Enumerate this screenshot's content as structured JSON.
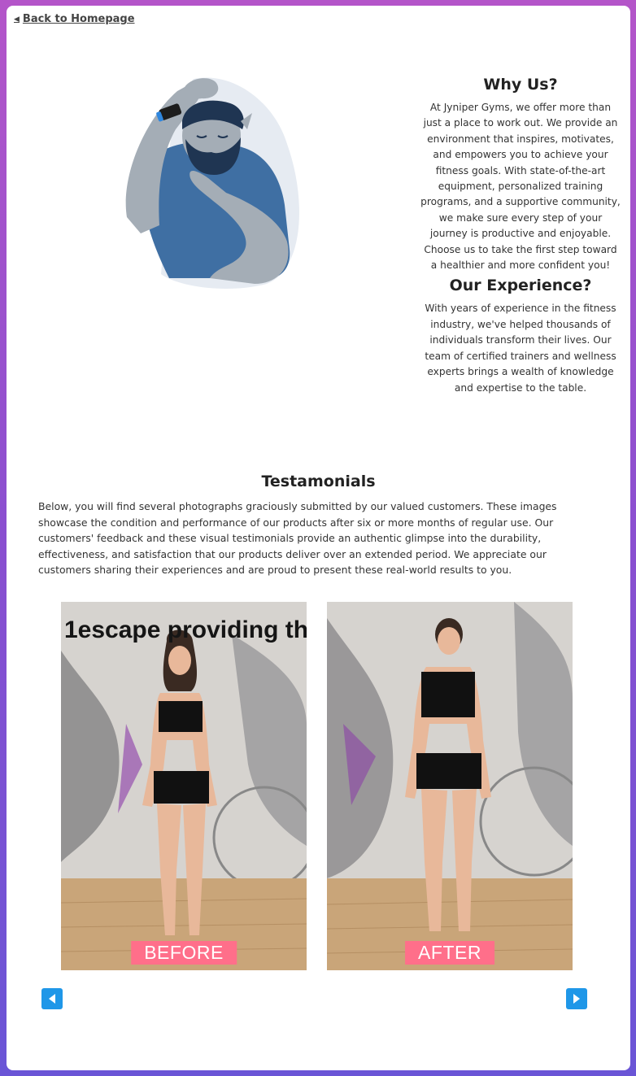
{
  "nav": {
    "back_label": "Back to Homepage"
  },
  "why_us": {
    "title": "Why Us?",
    "text": "At Jyniper Gyms, we offer more than just a place to work out. We provide an environment that inspires, motivates, and empowers you to achieve your fitness goals. With state-of-the-art equipment, personalized training programs, and a supportive community, we make sure every step of your journey is productive and enjoyable. Choose us to take the first step toward a healthier and more confident you!"
  },
  "experience": {
    "title": "Our Experience?",
    "text": "With years of experience in the fitness industry, we've helped thousands of individuals transform their lives. Our team of certified trainers and wellness experts brings a wealth of knowledge and expertise to the table."
  },
  "testimonials": {
    "title": "Testamonials",
    "text": "Below, you will find several photographs graciously submitted by our valued customers. These images showcase the condition and performance of our products after six or more months of regular use. Our customers' feedback and these visual testimonials provide an authentic glimpse into the durability, effectiveness, and satisfaction that our products deliver over an extended period. We appreciate our customers sharing their experiences and are proud to present these real-world results to you.",
    "photos": [
      {
        "label": "BEFORE",
        "banner_text": "1escape providing th"
      },
      {
        "label": "AFTER"
      }
    ]
  },
  "icons": {
    "back": "triangle-left-icon",
    "prev": "arrow-left-icon",
    "next": "arrow-right-icon"
  },
  "colors": {
    "nav_button": "#1f97e8",
    "label_bg": "#ff6f8a",
    "shirt": "#3f6fa3",
    "skin": "#a4adb6"
  }
}
